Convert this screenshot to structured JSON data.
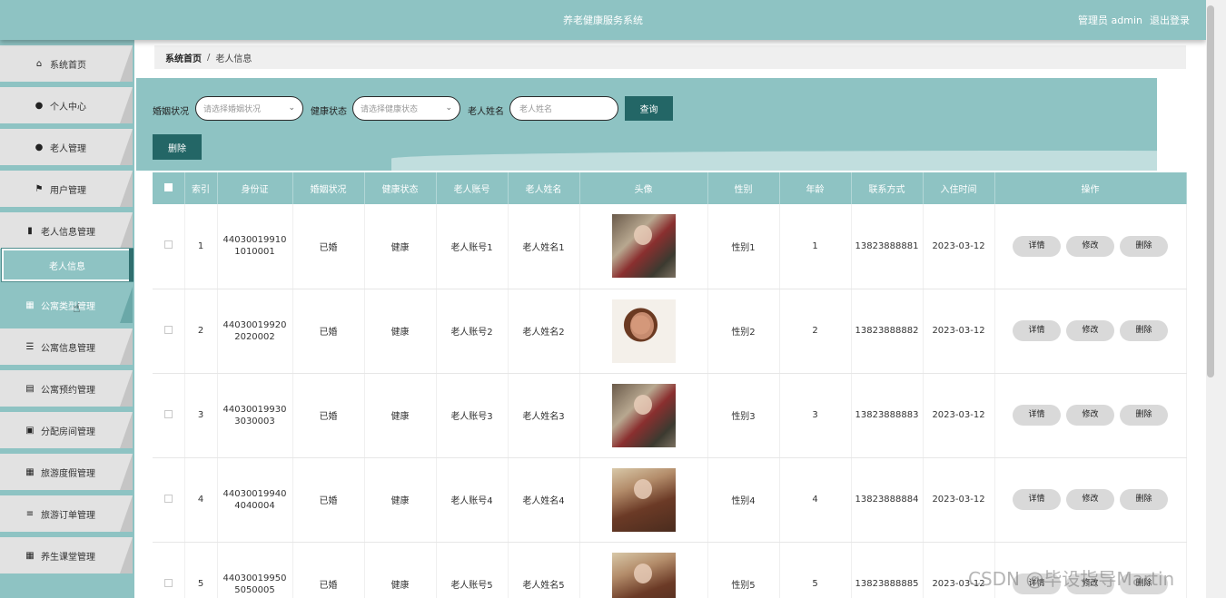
{
  "header": {
    "title": "养老健康服务系统",
    "admin_label": "管理员 admin",
    "logout": "退出登录"
  },
  "sidebar": {
    "items": [
      {
        "label": "系统首页",
        "icon": "home-icon",
        "glyph": "⌂"
      },
      {
        "label": "个人中心",
        "icon": "user-icon",
        "glyph": "●"
      },
      {
        "label": "老人管理",
        "icon": "bulb-icon",
        "glyph": "●"
      },
      {
        "label": "用户管理",
        "icon": "flag-icon",
        "glyph": "⚑"
      },
      {
        "label": "老人信息管理",
        "icon": "book-icon",
        "glyph": "▮"
      },
      {
        "label": "公寓类型管理",
        "icon": "grid-icon",
        "glyph": "▦"
      },
      {
        "label": "公寓信息管理",
        "icon": "sliders-icon",
        "glyph": "☰"
      },
      {
        "label": "公寓预约管理",
        "icon": "clipboard-icon",
        "glyph": "▤"
      },
      {
        "label": "分配房间管理",
        "icon": "clipboard-check-icon",
        "glyph": "▣"
      },
      {
        "label": "旅游度假管理",
        "icon": "grid-icon",
        "glyph": "▦"
      },
      {
        "label": "旅游订单管理",
        "icon": "list-icon",
        "glyph": "≡"
      },
      {
        "label": "养生课堂管理",
        "icon": "grid-icon",
        "glyph": "▦"
      }
    ],
    "active_sub": "老人信息",
    "active_sub_parent_index": 4
  },
  "breadcrumb": {
    "home": "系统首页",
    "separator": "/",
    "current": "老人信息"
  },
  "filters": {
    "marital_label": "婚姻状况",
    "marital_placeholder": "请选择婚姻状况",
    "health_label": "健康状态",
    "health_placeholder": "请选择健康状态",
    "name_label": "老人姓名",
    "name_placeholder": "老人姓名",
    "query_button": "查询",
    "delete_button": "删除"
  },
  "table": {
    "columns": [
      "索引",
      "身份证",
      "婚姻状况",
      "健康状态",
      "老人账号",
      "老人姓名",
      "头像",
      "性别",
      "年龄",
      "联系方式",
      "入住时间",
      "操作"
    ],
    "rows": [
      {
        "index": "1",
        "id_card_1": "44030019910",
        "id_card_2": "1010001",
        "marital": "已婚",
        "health": "健康",
        "account": "老人账号1",
        "name": "老人姓名1",
        "avatar": "av1",
        "gender": "性别1",
        "age": "1",
        "phone": "13823888881",
        "checkin": "2023-03-12"
      },
      {
        "index": "2",
        "id_card_1": "44030019920",
        "id_card_2": "2020002",
        "marital": "已婚",
        "health": "健康",
        "account": "老人账号2",
        "name": "老人姓名2",
        "avatar": "av2",
        "gender": "性别2",
        "age": "2",
        "phone": "13823888882",
        "checkin": "2023-03-12"
      },
      {
        "index": "3",
        "id_card_1": "44030019930",
        "id_card_2": "3030003",
        "marital": "已婚",
        "health": "健康",
        "account": "老人账号3",
        "name": "老人姓名3",
        "avatar": "av1",
        "gender": "性别3",
        "age": "3",
        "phone": "13823888883",
        "checkin": "2023-03-12"
      },
      {
        "index": "4",
        "id_card_1": "44030019940",
        "id_card_2": "4040004",
        "marital": "已婚",
        "health": "健康",
        "account": "老人账号4",
        "name": "老人姓名4",
        "avatar": "av3",
        "gender": "性别4",
        "age": "4",
        "phone": "13823888884",
        "checkin": "2023-03-12"
      },
      {
        "index": "5",
        "id_card_1": "44030019950",
        "id_card_2": "5050005",
        "marital": "已婚",
        "health": "健康",
        "account": "老人账号5",
        "name": "老人姓名5",
        "avatar": "av3",
        "gender": "性别5",
        "age": "5",
        "phone": "13823888885",
        "checkin": "2023-03-12"
      }
    ],
    "actions": {
      "detail": "详情",
      "edit": "修改",
      "delete": "删除"
    }
  },
  "watermark": "CSDN @毕设指导Martin",
  "colors": {
    "accent": "#8ec3c3",
    "button_dark": "#236666",
    "menu_bg": "#e2e2e2"
  }
}
